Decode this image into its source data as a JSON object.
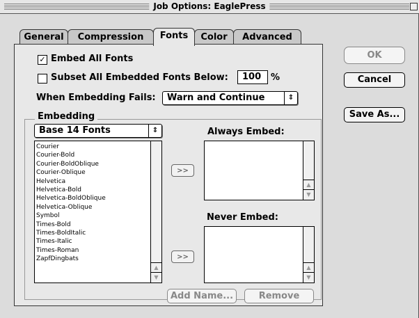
{
  "window": {
    "title": "Job Options: EaglePress"
  },
  "tabs": [
    {
      "label": "General"
    },
    {
      "label": "Compression"
    },
    {
      "label": "Fonts"
    },
    {
      "label": "Color"
    },
    {
      "label": "Advanced"
    }
  ],
  "active_tab": "Fonts",
  "fonts": {
    "embed_all": {
      "label": "Embed All Fonts",
      "checked": "☑",
      "mark": "✓"
    },
    "subset": {
      "label": "Subset All Embedded Fonts Below:",
      "checked": false,
      "value": "100",
      "unit": "%"
    },
    "embedding_fails": {
      "label": "When Embedding Fails:",
      "value": "Warn and Continue"
    },
    "embedding_group": {
      "title": "Embedding",
      "source_popup": "Base 14 Fonts",
      "font_list": [
        "Courier",
        "Courier-Bold",
        "Courier-BoldOblique",
        "Courier-Oblique",
        "Helvetica",
        "Helvetica-Bold",
        "Helvetica-BoldOblique",
        "Helvetica-Oblique",
        "Symbol",
        "Times-Bold",
        "Times-BoldItalic",
        "Times-Italic",
        "Times-Roman",
        "ZapfDingbats"
      ],
      "always_embed_label": "Always Embed:",
      "never_embed_label": "Never Embed:",
      "add_to_always": ">>",
      "add_to_never": ">>",
      "add_name_button": "Add Name...",
      "remove_button": "Remove"
    }
  },
  "buttons": {
    "ok": "OK",
    "cancel": "Cancel",
    "save_as": "Save As..."
  }
}
